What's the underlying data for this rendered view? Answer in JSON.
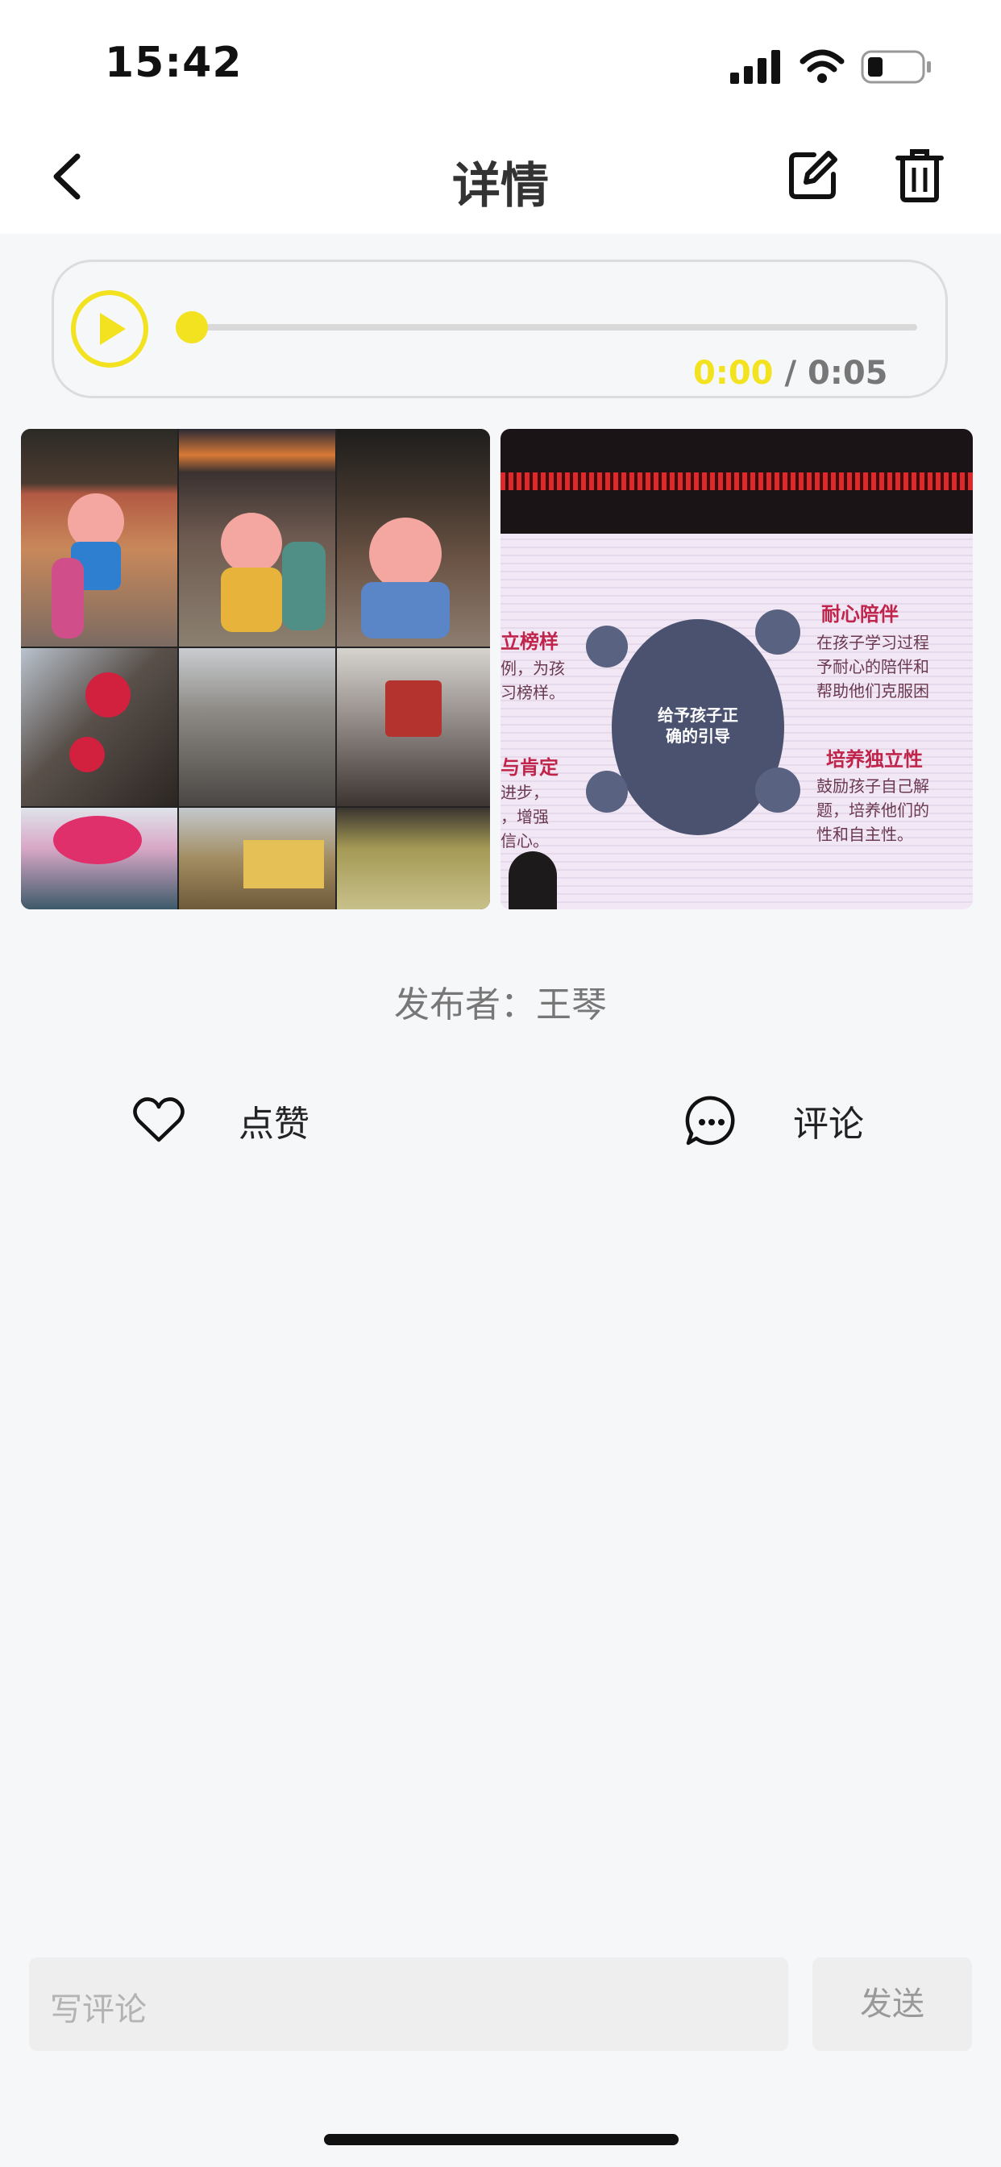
{
  "status_bar": {
    "time": "15:42"
  },
  "nav": {
    "title": "详情"
  },
  "audio": {
    "current_time": "0:00",
    "separator": "/",
    "total_time": "0:05",
    "progress": 0.0
  },
  "slide": {
    "center_text_line1": "给予孩子正",
    "center_text_line2": "确的引导",
    "left_heading_1": "立榜样",
    "left_text_1a": "例，为孩",
    "left_text_1b": "习榜样。",
    "left_heading_2": "与肯定",
    "left_text_2a": "进步，",
    "left_text_2b": "，增强",
    "left_text_2c": "信心。",
    "right_heading_1": "耐心陪伴",
    "right_text_1a": "在孩子学习过程",
    "right_text_1b": "予耐心的陪伴和",
    "right_text_1c": "帮助他们克服困",
    "right_heading_2": "培养独立性",
    "right_text_2a": "鼓励孩子自己解",
    "right_text_2b": "题，培养他们的",
    "right_text_2c": "性和自主性。"
  },
  "post": {
    "publisher": "发布者：王琴"
  },
  "actions": {
    "like_label": "点赞",
    "comment_label": "评论"
  },
  "comment_bar": {
    "placeholder": "写评论",
    "send_label": "发送"
  },
  "colors": {
    "accent": "#f2e21f",
    "background": "#f6f7f9"
  }
}
